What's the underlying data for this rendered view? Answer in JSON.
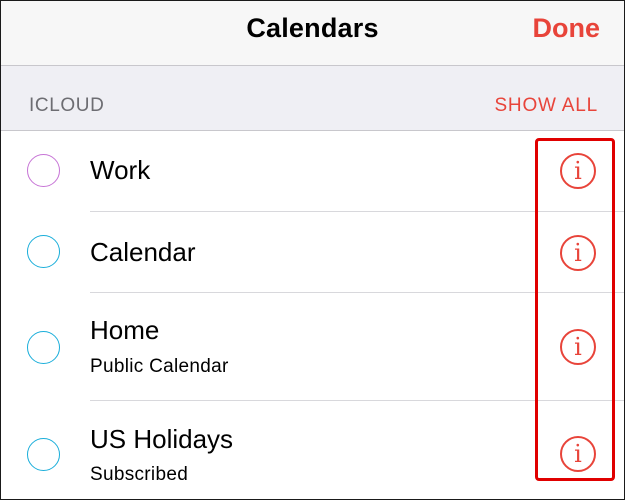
{
  "nav": {
    "title": "Calendars",
    "done_label": "Done"
  },
  "section": {
    "label": "ICLOUD",
    "show_all_label": "SHOW ALL"
  },
  "calendars": [
    {
      "name": "Work",
      "subtitle": "",
      "color": "#c774d6"
    },
    {
      "name": "Calendar",
      "subtitle": "",
      "color": "#1aaeda"
    },
    {
      "name": "Home",
      "subtitle": "Public Calendar",
      "color": "#1aaeda"
    },
    {
      "name": "US Holidays",
      "subtitle": "Subscribed",
      "color": "#1aaeda"
    }
  ],
  "info_icon_glyph": "i",
  "icons": {
    "info": "info-circle-icon"
  },
  "colors": {
    "accent": "#e8443a",
    "highlight": "#e00000",
    "nav_background": "#f7f7f7",
    "section_background": "#efeff4"
  }
}
